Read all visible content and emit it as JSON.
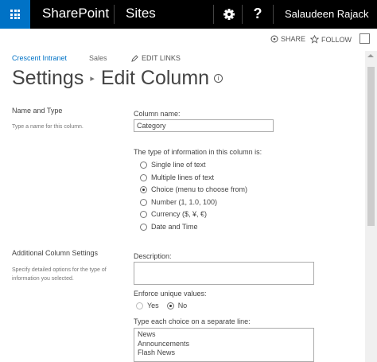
{
  "suitebar": {
    "brand": "SharePoint",
    "sites": "Sites",
    "help": "?",
    "user": "Salaudeen Rajack"
  },
  "actionbar": {
    "share": "SHARE",
    "follow": "FOLLOW"
  },
  "nav": {
    "site": "Crescent Intranet",
    "sales": "Sales",
    "edit_links": "EDIT LINKS"
  },
  "title": {
    "parent": "Settings",
    "current": "Edit Column"
  },
  "name_type": {
    "heading": "Name and Type",
    "description": "Type a name for this column.",
    "column_name_label": "Column name:",
    "column_name_value": "Category",
    "type_label": "The type of information in this column is:",
    "types": [
      {
        "label": "Single line of text",
        "checked": false
      },
      {
        "label": "Multiple lines of text",
        "checked": false
      },
      {
        "label": "Choice (menu to choose from)",
        "checked": true
      },
      {
        "label": "Number (1, 1.0, 100)",
        "checked": false
      },
      {
        "label": "Currency ($, ¥, €)",
        "checked": false
      },
      {
        "label": "Date and Time",
        "checked": false
      }
    ]
  },
  "additional": {
    "heading": "Additional Column Settings",
    "description": "Specify detailed options for the type of information you selected.",
    "description_label": "Description:",
    "description_value": "",
    "unique_label": "Enforce unique values:",
    "unique_yes": "Yes",
    "unique_no": "No",
    "unique_selected": "No",
    "choices_label": "Type each choice on a separate line:",
    "choices": [
      "News",
      "Announcements",
      "Flash News"
    ]
  },
  "colors": {
    "suitebar_bg": "#000000",
    "waffle_bg": "#0072c6",
    "link": "#0072c6"
  },
  "icons": [
    "app-launcher-icon",
    "gear-icon",
    "help-icon",
    "share-icon",
    "follow-star-icon",
    "focus-icon",
    "pencil-icon",
    "info-icon"
  ]
}
